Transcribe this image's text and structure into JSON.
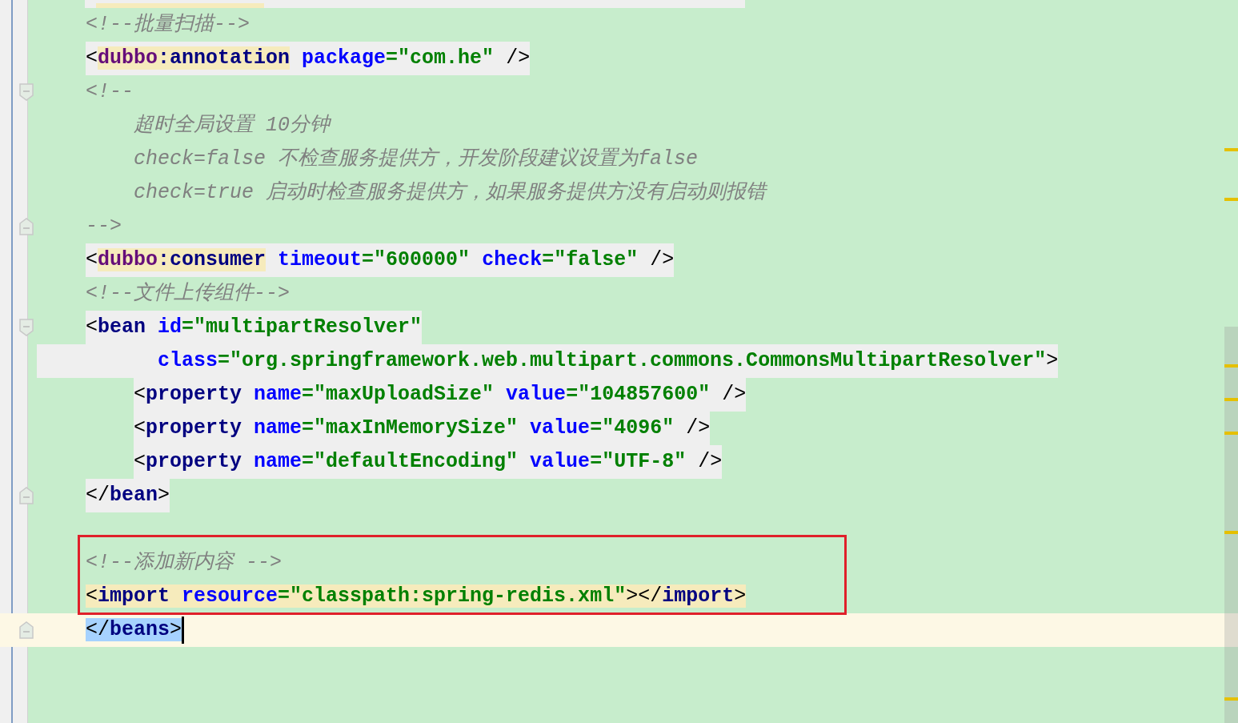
{
  "editor": {
    "lines": [
      {
        "fold_start": false,
        "fold_end": false,
        "highlighted": false,
        "tokens": [
          {
            "kind": "comment",
            "text": "<!--批量扫描-->"
          }
        ]
      },
      {
        "fold_start": false,
        "fold_end": false,
        "highlighted": true,
        "tokens": [
          {
            "kind": "punct",
            "text": "<"
          },
          {
            "kind": "ns",
            "text": "dubbo",
            "matched": true
          },
          {
            "kind": "tag",
            "text": ":annotation",
            "matched": true
          },
          {
            "kind": "attr",
            "text": "package"
          },
          {
            "kind": "value",
            "text": "=\"com.he\""
          },
          {
            "kind": "punct",
            "text": " />"
          }
        ]
      },
      {
        "fold_start": true,
        "fold_end": false,
        "highlighted": false,
        "tokens": [
          {
            "kind": "comment",
            "text": "<!--"
          }
        ],
        "children": [
          {
            "fold_start": false,
            "fold_end": false,
            "highlighted": false,
            "tokens": [
              {
                "kind": "comment",
                "text": "超时全局设置 10分钟"
              }
            ]
          },
          {
            "fold_start": false,
            "fold_end": false,
            "highlighted": false,
            "tokens": [
              {
                "kind": "comment",
                "text": "check=false 不检查服务提供方，开发阶段建议设置为false"
              }
            ]
          },
          {
            "fold_start": false,
            "fold_end": false,
            "highlighted": false,
            "tokens": [
              {
                "kind": "comment",
                "text": "check=true 启动时检查服务提供方，如果服务提供方没有启动则报错"
              }
            ]
          }
        ]
      },
      {
        "fold_start": false,
        "fold_end": true,
        "highlighted": false,
        "tokens": [
          {
            "kind": "comment",
            "text": "-->"
          }
        ]
      },
      {
        "fold_start": false,
        "fold_end": false,
        "highlighted": true,
        "tokens": [
          {
            "kind": "punct",
            "text": "<"
          },
          {
            "kind": "ns",
            "text": "dubbo",
            "matched": true
          },
          {
            "kind": "tag",
            "text": ":consumer",
            "matched": true
          },
          {
            "kind": "attr",
            "text": "timeout"
          },
          {
            "kind": "value",
            "text": "=\"600000\""
          },
          {
            "kind": "attr",
            "text": "check"
          },
          {
            "kind": "value",
            "text": "=\"false\""
          },
          {
            "kind": "punct",
            "text": " />"
          }
        ]
      },
      {
        "fold_start": false,
        "fold_end": false,
        "highlighted": false,
        "tokens": [
          {
            "kind": "comment",
            "text": "<!--文件上传组件-->"
          }
        ]
      },
      {
        "fold_start": true,
        "fold_end": false,
        "highlighted": true,
        "tokens": [
          {
            "kind": "punct",
            "text": "<"
          },
          {
            "kind": "tag",
            "text": "bean"
          },
          {
            "kind": "attr",
            "text": "id"
          },
          {
            "kind": "value",
            "text": "=\"multipartResolver\""
          }
        ],
        "continuation": [
          {
            "kind": "attr",
            "text": "class"
          },
          {
            "kind": "value",
            "text": "=\"org.springframework.web.multipart.commons.CommonsMultipartResolver\""
          },
          {
            "kind": "punct",
            "text": ">"
          }
        ],
        "children": [
          {
            "fold_start": false,
            "fold_end": false,
            "highlighted": true,
            "tokens": [
              {
                "kind": "punct",
                "text": "<"
              },
              {
                "kind": "tag",
                "text": "property"
              },
              {
                "kind": "attr",
                "text": "name"
              },
              {
                "kind": "value",
                "text": "=\"maxUploadSize\""
              },
              {
                "kind": "attr",
                "text": "value"
              },
              {
                "kind": "value",
                "text": "=\"104857600\""
              },
              {
                "kind": "punct",
                "text": " />"
              }
            ]
          },
          {
            "fold_start": false,
            "fold_end": false,
            "highlighted": true,
            "tokens": [
              {
                "kind": "punct",
                "text": "<"
              },
              {
                "kind": "tag",
                "text": "property"
              },
              {
                "kind": "attr",
                "text": "name"
              },
              {
                "kind": "value",
                "text": "=\"maxInMemorySize\""
              },
              {
                "kind": "attr",
                "text": "value"
              },
              {
                "kind": "value",
                "text": "=\"4096\""
              },
              {
                "kind": "punct",
                "text": " />"
              }
            ]
          },
          {
            "fold_start": false,
            "fold_end": false,
            "highlighted": true,
            "tokens": [
              {
                "kind": "punct",
                "text": "<"
              },
              {
                "kind": "tag",
                "text": "property"
              },
              {
                "kind": "attr",
                "text": "name"
              },
              {
                "kind": "value",
                "text": "=\"defaultEncoding\""
              },
              {
                "kind": "attr",
                "text": "value"
              },
              {
                "kind": "value",
                "text": "=\"UTF-8\""
              },
              {
                "kind": "punct",
                "text": " />"
              }
            ]
          }
        ]
      },
      {
        "fold_start": false,
        "fold_end": true,
        "highlighted": true,
        "tokens": [
          {
            "kind": "punct",
            "text": "</"
          },
          {
            "kind": "tag",
            "text": "bean"
          },
          {
            "kind": "punct",
            "text": ">"
          }
        ]
      },
      {
        "fold_start": false,
        "fold_end": false,
        "highlighted": false,
        "gap_before": true,
        "tokens": [
          {
            "kind": "comment",
            "text": "<!--添加新内容 -->"
          }
        ]
      },
      {
        "fold_start": false,
        "fold_end": false,
        "highlighted": false,
        "tokens": [
          {
            "kind": "punct",
            "text": "<",
            "matched": true
          },
          {
            "kind": "tag",
            "text": "import",
            "matched": true
          },
          {
            "kind": "attr",
            "text": "resource",
            "matched": true
          },
          {
            "kind": "value",
            "text": "=\"classpath:spring-redis.xml\"",
            "matched": true
          },
          {
            "kind": "punct",
            "text": "></",
            "matched": true
          },
          {
            "kind": "tag",
            "text": "import",
            "matched": true
          },
          {
            "kind": "punct",
            "text": ">",
            "matched": true
          }
        ]
      },
      {
        "fold_start": false,
        "fold_end": true,
        "highlighted": false,
        "current": true,
        "tokens": [
          {
            "kind": "punct",
            "text": "</",
            "selected": true
          },
          {
            "kind": "tag",
            "text": "beans",
            "selected": true
          },
          {
            "kind": "punct",
            "text": ">",
            "selected": true
          }
        ]
      }
    ]
  }
}
